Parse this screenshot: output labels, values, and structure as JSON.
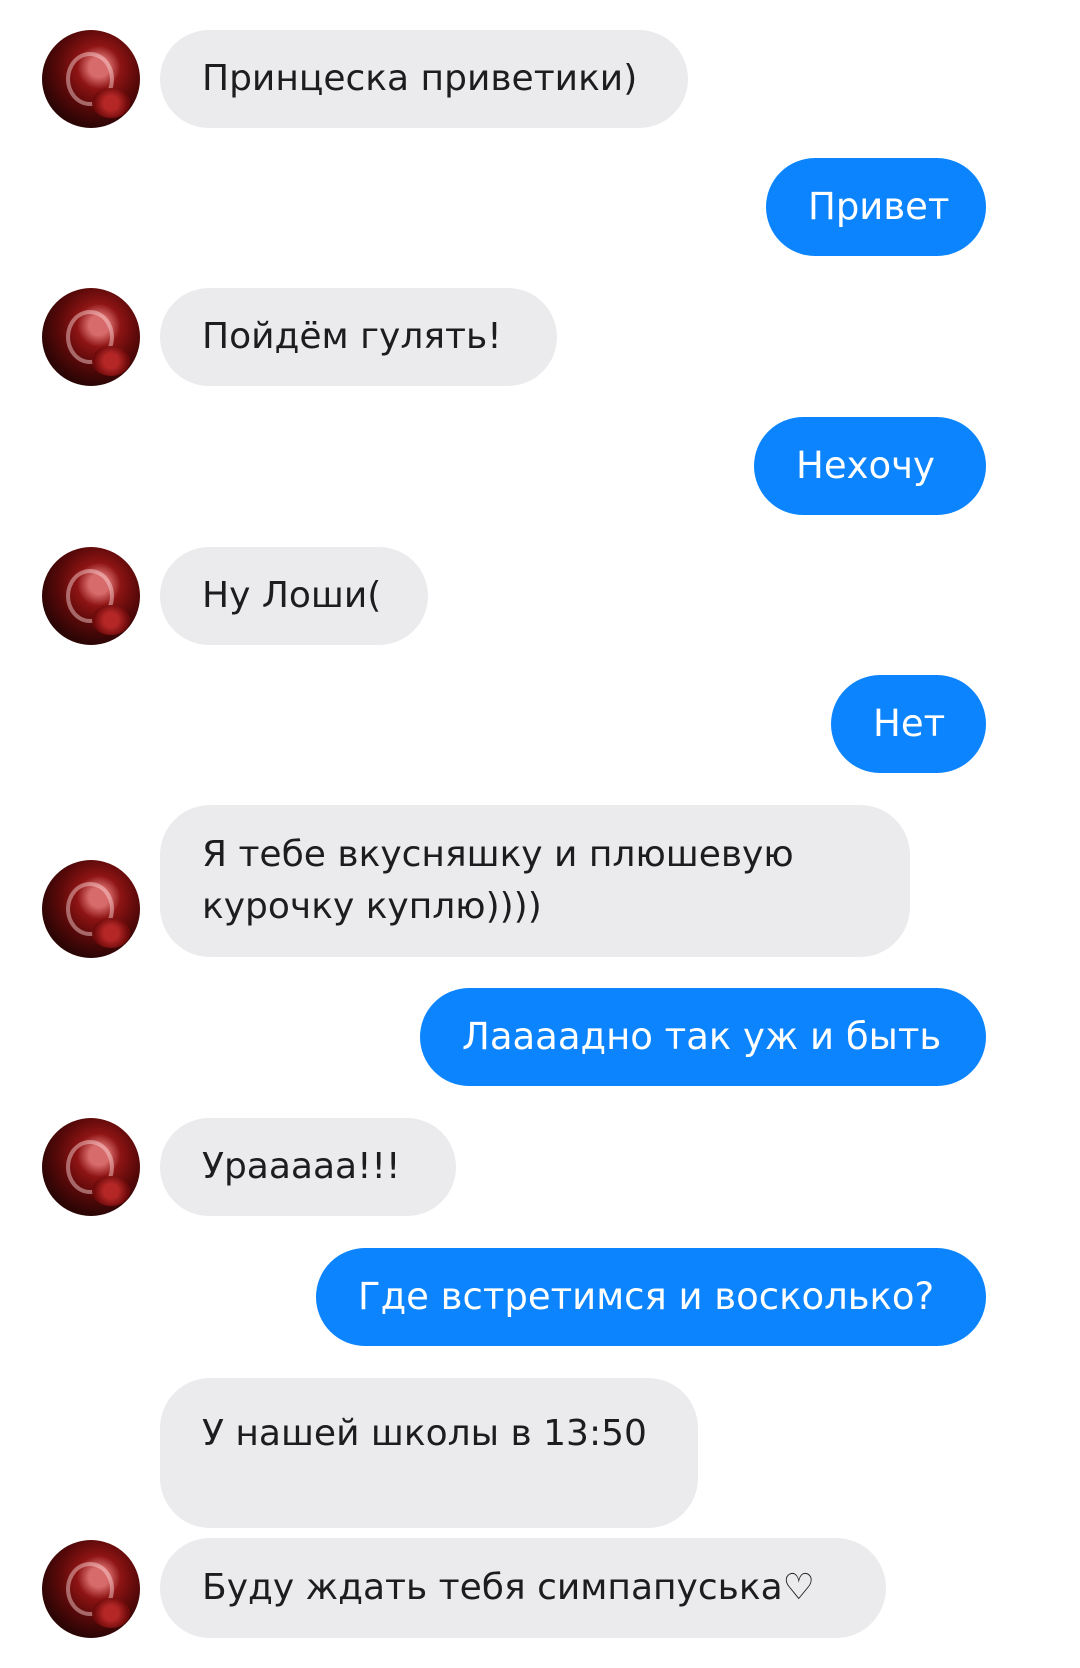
{
  "messages": [
    {
      "side": "in",
      "text": "Принцеска приветики)"
    },
    {
      "side": "out",
      "text": "Привет"
    },
    {
      "side": "in",
      "text": "Пойдём гулять!"
    },
    {
      "side": "out",
      "text": "Нехочу"
    },
    {
      "side": "in",
      "text": "Ну Лоши("
    },
    {
      "side": "out",
      "text": "Нет"
    },
    {
      "side": "in",
      "text": "Я тебе вкусняшку и плюшевую",
      "text2": "курочку куплю))))"
    },
    {
      "side": "out",
      "text": "Лаааадно так уж и быть"
    },
    {
      "side": "in",
      "text": "Урааааа!!!"
    },
    {
      "side": "out",
      "text": "Где встретимся и восколько?"
    },
    {
      "side": "in",
      "text": "У нашей школы в 13:50"
    },
    {
      "side": "in",
      "text": "Буду ждать тебя симпапуська♡"
    }
  ],
  "colors": {
    "incoming_bubble": "#ebebed",
    "outgoing_bubble": "#0b84fe"
  },
  "icons": {
    "avatar": "contact-avatar"
  }
}
